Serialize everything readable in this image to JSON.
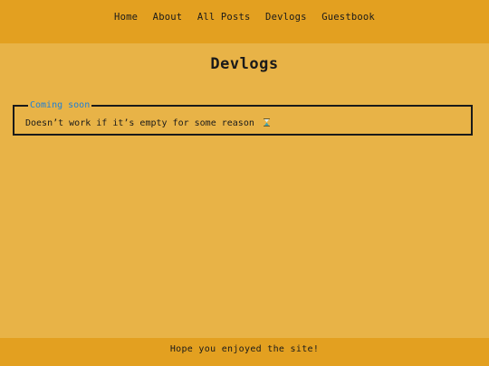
{
  "nav": {
    "items": [
      "Home",
      "About",
      "All Posts",
      "Devlogs",
      "Guestbook"
    ]
  },
  "page": {
    "title": "Devlogs"
  },
  "card": {
    "legend": "Coming soon",
    "text": "Doesn’t work if it’s empty for some reason",
    "icon": "hourglass-icon"
  },
  "footer": {
    "text": "Hope you enjoyed the site!"
  },
  "colors": {
    "background": "#e8b347",
    "header": "#e3a020",
    "legend": "#1e7fd6",
    "text": "#1a1a1a"
  }
}
